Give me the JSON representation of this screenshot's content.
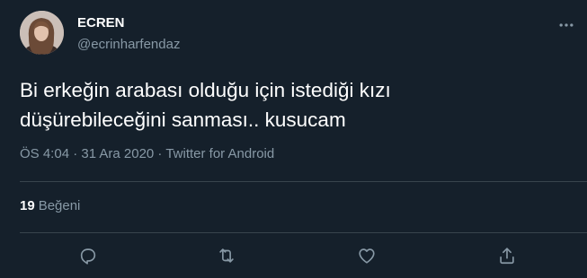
{
  "author": {
    "display_name": "ECREN",
    "handle": "@ecrinharfendaz",
    "avatar_icon": "profile-photo"
  },
  "tweet": {
    "text": "Bi erkeğin arabası olduğu için istediği kızı\ndüşürebileceğini sanması.. kusucam",
    "meta": "ÖS 4:04 · 31 Ara 2020 · Twitter for Android"
  },
  "stats": {
    "likes_count": "19",
    "likes_label": "Beğeni"
  },
  "actions": [
    "reply-icon",
    "retweet-icon",
    "like-icon",
    "share-icon"
  ],
  "colors": {
    "background": "#15202b",
    "secondary_text": "#8899a6",
    "divider": "#38444d"
  }
}
